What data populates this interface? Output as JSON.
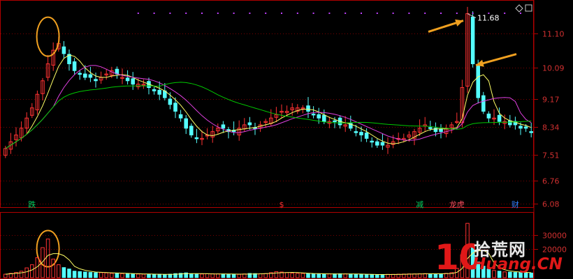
{
  "chart_data": [
    {
      "type": "candlestick",
      "title": "",
      "y_ticks": [
        "11.10",
        "10.09",
        "9.17",
        "8.34",
        "7.51",
        "6.76",
        "6.08"
      ],
      "ylim": [
        5.95,
        12.0
      ],
      "peak_label": "11.68",
      "moving_averages": [
        {
          "color": "#ffff66"
        },
        {
          "color": "#e040e0"
        },
        {
          "color": "#00c800"
        }
      ],
      "event_markers": [
        {
          "text": "跌",
          "color": "#00d060"
        },
        {
          "text": "$",
          "color": "#ff3030"
        },
        {
          "text": "减",
          "color": "#00d060"
        },
        {
          "text": "龙虎",
          "color": "#ff5060"
        },
        {
          "text": "财",
          "color": "#3080ff"
        }
      ],
      "close_approx": [
        7.7,
        7.9,
        8.1,
        8.3,
        8.6,
        8.9,
        9.3,
        9.7,
        10.2,
        10.6,
        10.8,
        10.5,
        10.2,
        10.0,
        9.9,
        9.8,
        9.8,
        9.7,
        9.8,
        9.9,
        10.0,
        9.9,
        9.8,
        9.7,
        9.6,
        9.6,
        9.6,
        9.5,
        9.4,
        9.3,
        9.2,
        9.0,
        8.8,
        8.6,
        8.3,
        8.1,
        8.0,
        8.0,
        8.1,
        8.2,
        8.3,
        8.3,
        8.2,
        8.2,
        8.3,
        8.4,
        8.4,
        8.3,
        8.4,
        8.5,
        8.6,
        8.7,
        8.8,
        8.8,
        8.9,
        8.9,
        8.9,
        8.8,
        8.7,
        8.6,
        8.5,
        8.5,
        8.5,
        8.4,
        8.4,
        8.3,
        8.2,
        8.1,
        8.0,
        7.9,
        7.8,
        7.8,
        7.8,
        7.9,
        8.0,
        8.0,
        8.1,
        8.2,
        8.3,
        8.4,
        8.3,
        8.2,
        8.2,
        8.3,
        8.4,
        8.5,
        9.5,
        11.68,
        10.2,
        9.2,
        8.8,
        8.6,
        8.6,
        8.5,
        8.5,
        8.4,
        8.4,
        8.3,
        8.3,
        8.2
      ]
    },
    {
      "type": "bar",
      "title": "",
      "y_ticks": [
        "30000",
        "20000"
      ],
      "ylim": [
        0,
        42000
      ],
      "volume_approx": [
        2400,
        3000,
        3600,
        4500,
        6800,
        9000,
        14000,
        21000,
        27000,
        13000,
        9000,
        7000,
        6000,
        4500,
        4200,
        3900,
        3600,
        3400,
        3500,
        3300,
        3000,
        3000,
        2800,
        2700,
        2600,
        2500,
        2400,
        2400,
        2300,
        2300,
        2200,
        2400,
        2800,
        3000,
        3300,
        2700,
        2400,
        2500,
        2700,
        2700,
        2600,
        2500,
        2400,
        2300,
        2300,
        2600,
        2900,
        2800,
        2700,
        2800,
        3500,
        4200,
        3900,
        3500,
        3100,
        3000,
        2900,
        2800,
        2700,
        2600,
        2500,
        2600,
        2600,
        2700,
        2600,
        2500,
        2400,
        2300,
        2200,
        2100,
        2100,
        2200,
        2300,
        2300,
        2400,
        2500,
        2600,
        2600,
        2700,
        2800,
        2700,
        2600,
        2700,
        3000,
        3500,
        6500,
        16000,
        38000,
        22000,
        11000,
        8000,
        6000,
        5000,
        4500,
        4000,
        3800,
        3600,
        3500,
        3300,
        3200
      ]
    }
  ],
  "watermark": {
    "logo_number": "10",
    "brand_text": "拾荒网",
    "domain_text": "Huang.CN"
  }
}
